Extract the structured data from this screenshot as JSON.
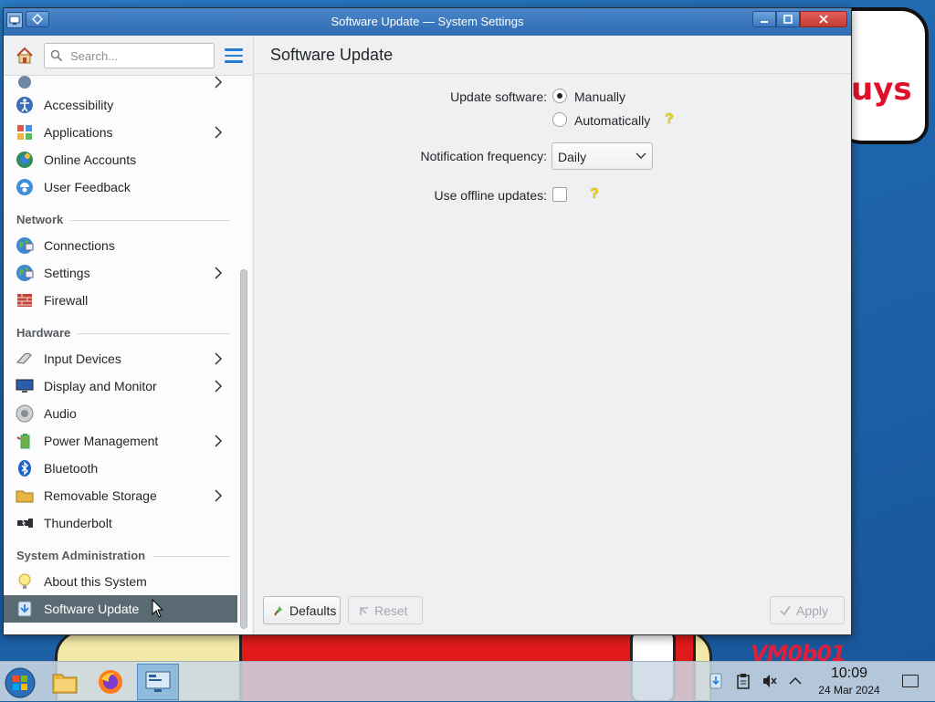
{
  "window": {
    "title": "Software Update — System Settings"
  },
  "sidebar": {
    "search_placeholder": "Search...",
    "items_top": [
      {
        "label": "Accessibility",
        "icon": "accessibility-icon",
        "has_submenu": false
      },
      {
        "label": "Applications",
        "icon": "applications-icon",
        "has_submenu": true
      },
      {
        "label": "Online Accounts",
        "icon": "online-accounts-icon",
        "has_submenu": false
      },
      {
        "label": "User Feedback",
        "icon": "user-feedback-icon",
        "has_submenu": false
      }
    ],
    "sections": {
      "network": "Network",
      "hardware": "Hardware",
      "system_administration": "System Administration"
    },
    "network_items": [
      {
        "label": "Connections",
        "icon": "globe-icon",
        "has_submenu": false
      },
      {
        "label": "Settings",
        "icon": "globe-icon",
        "has_submenu": true
      },
      {
        "label": "Firewall",
        "icon": "firewall-icon",
        "has_submenu": false
      }
    ],
    "hardware_items": [
      {
        "label": "Input Devices",
        "icon": "mouse-icon",
        "has_submenu": true
      },
      {
        "label": "Display and Monitor",
        "icon": "monitor-icon",
        "has_submenu": true
      },
      {
        "label": "Audio",
        "icon": "speaker-icon",
        "has_submenu": false
      },
      {
        "label": "Power Management",
        "icon": "battery-icon",
        "has_submenu": true
      },
      {
        "label": "Bluetooth",
        "icon": "bluetooth-icon",
        "has_submenu": false
      },
      {
        "label": "Removable Storage",
        "icon": "folder-icon",
        "has_submenu": true
      },
      {
        "label": "Thunderbolt",
        "icon": "thunderbolt-icon",
        "has_submenu": false
      }
    ],
    "sysadmin_items": [
      {
        "label": "About this System",
        "icon": "lightbulb-icon",
        "has_submenu": false
      },
      {
        "label": "Software Update",
        "icon": "software-update-icon",
        "has_submenu": false,
        "selected": true
      }
    ]
  },
  "main": {
    "page_title": "Software Update",
    "update_software_label": "Update software:",
    "update_options": [
      {
        "label": "Manually",
        "checked": true
      },
      {
        "label": "Automatically",
        "checked": false
      }
    ],
    "notification_frequency_label": "Notification frequency:",
    "notification_frequency_value": "Daily",
    "offline_updates_label": "Use offline updates:",
    "offline_updates_checked": false,
    "buttons": {
      "defaults": "Defaults",
      "reset": "Reset",
      "apply": "Apply"
    }
  },
  "taskbar": {
    "clock_time": "10:09",
    "clock_date": "24 Mar 2024",
    "apps": [
      "file-manager-icon",
      "firefox-icon",
      "system-settings-icon"
    ],
    "tray": [
      "updates-icon",
      "clipboard-icon",
      "volume-muted-icon",
      "chevron-up-icon"
    ]
  },
  "colors": {
    "titlebar": "#3a77bb",
    "selection": "#5a6a72",
    "accent": "#2a7bd6"
  }
}
